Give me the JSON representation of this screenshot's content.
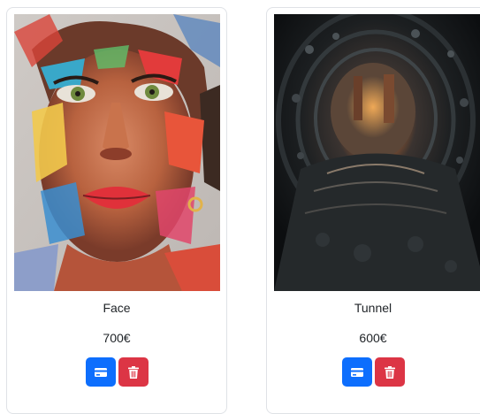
{
  "products": [
    {
      "title": "Face",
      "price": "700€",
      "image_icon": "face-painting-image",
      "buttons": {
        "buy_icon": "card-icon",
        "delete_icon": "trash-icon"
      }
    },
    {
      "title": "Tunnel",
      "price": "600€",
      "image_icon": "tunnel-photo-image",
      "buttons": {
        "buy_icon": "card-icon",
        "delete_icon": "trash-icon"
      }
    }
  ],
  "colors": {
    "primary": "#0d6efd",
    "danger": "#dc3545",
    "card_border": "#dfe2e6"
  }
}
